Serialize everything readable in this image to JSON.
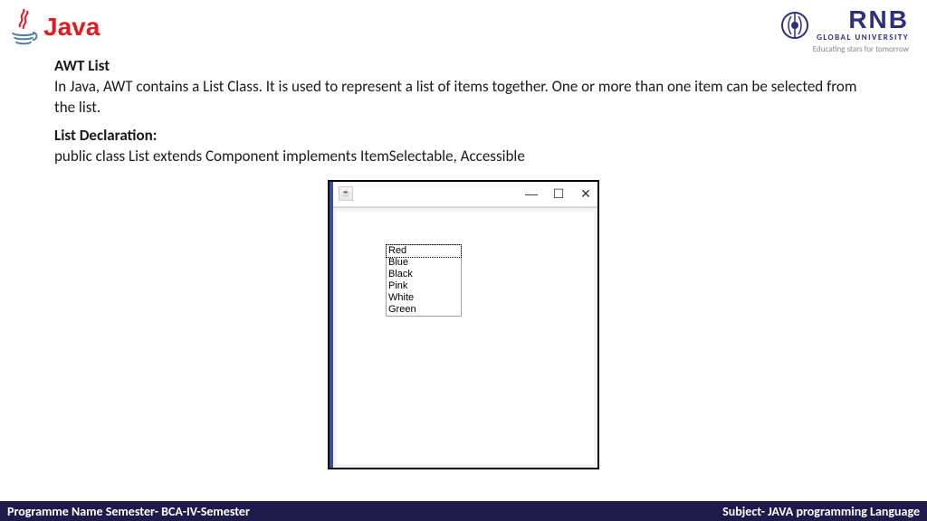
{
  "branding": {
    "java_text": "Java",
    "rnb_main": "RNB",
    "rnb_sub": "GLOBAL UNIVERSITY",
    "rnb_tag": "Educating stars for tomorrow"
  },
  "content": {
    "title": "AWT List",
    "para1": "In Java, AWT contains a List Class. It is used to represent a list of items together. One or more than one item can be selected from the list.",
    "decl_title": "List Declaration:",
    "decl_code": "public class List extends Component implements ItemSelectable, Accessible"
  },
  "window": {
    "controls": {
      "minimize": "—",
      "maximize": "☐",
      "close": "✕"
    },
    "list_items": [
      "Red",
      "Blue",
      "Black",
      "Pink",
      "White",
      "Green"
    ],
    "selected_index": 0
  },
  "footer": {
    "left": "Programme Name Semester- BCA-IV-Semester",
    "right": "Subject- JAVA programming Language"
  }
}
